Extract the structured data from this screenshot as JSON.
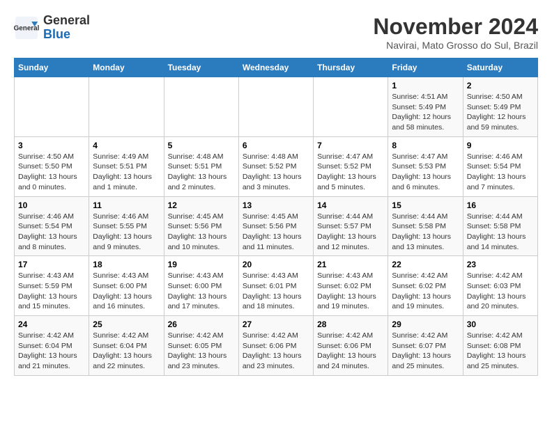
{
  "header": {
    "logo_line1": "General",
    "logo_line2": "Blue",
    "month_title": "November 2024",
    "location": "Navirai, Mato Grosso do Sul, Brazil"
  },
  "weekdays": [
    "Sunday",
    "Monday",
    "Tuesday",
    "Wednesday",
    "Thursday",
    "Friday",
    "Saturday"
  ],
  "weeks": [
    [
      {
        "day": "",
        "detail": ""
      },
      {
        "day": "",
        "detail": ""
      },
      {
        "day": "",
        "detail": ""
      },
      {
        "day": "",
        "detail": ""
      },
      {
        "day": "",
        "detail": ""
      },
      {
        "day": "1",
        "detail": "Sunrise: 4:51 AM\nSunset: 5:49 PM\nDaylight: 12 hours and 58 minutes."
      },
      {
        "day": "2",
        "detail": "Sunrise: 4:50 AM\nSunset: 5:49 PM\nDaylight: 12 hours and 59 minutes."
      }
    ],
    [
      {
        "day": "3",
        "detail": "Sunrise: 4:50 AM\nSunset: 5:50 PM\nDaylight: 13 hours and 0 minutes."
      },
      {
        "day": "4",
        "detail": "Sunrise: 4:49 AM\nSunset: 5:51 PM\nDaylight: 13 hours and 1 minute."
      },
      {
        "day": "5",
        "detail": "Sunrise: 4:48 AM\nSunset: 5:51 PM\nDaylight: 13 hours and 2 minutes."
      },
      {
        "day": "6",
        "detail": "Sunrise: 4:48 AM\nSunset: 5:52 PM\nDaylight: 13 hours and 3 minutes."
      },
      {
        "day": "7",
        "detail": "Sunrise: 4:47 AM\nSunset: 5:52 PM\nDaylight: 13 hours and 5 minutes."
      },
      {
        "day": "8",
        "detail": "Sunrise: 4:47 AM\nSunset: 5:53 PM\nDaylight: 13 hours and 6 minutes."
      },
      {
        "day": "9",
        "detail": "Sunrise: 4:46 AM\nSunset: 5:54 PM\nDaylight: 13 hours and 7 minutes."
      }
    ],
    [
      {
        "day": "10",
        "detail": "Sunrise: 4:46 AM\nSunset: 5:54 PM\nDaylight: 13 hours and 8 minutes."
      },
      {
        "day": "11",
        "detail": "Sunrise: 4:46 AM\nSunset: 5:55 PM\nDaylight: 13 hours and 9 minutes."
      },
      {
        "day": "12",
        "detail": "Sunrise: 4:45 AM\nSunset: 5:56 PM\nDaylight: 13 hours and 10 minutes."
      },
      {
        "day": "13",
        "detail": "Sunrise: 4:45 AM\nSunset: 5:56 PM\nDaylight: 13 hours and 11 minutes."
      },
      {
        "day": "14",
        "detail": "Sunrise: 4:44 AM\nSunset: 5:57 PM\nDaylight: 13 hours and 12 minutes."
      },
      {
        "day": "15",
        "detail": "Sunrise: 4:44 AM\nSunset: 5:58 PM\nDaylight: 13 hours and 13 minutes."
      },
      {
        "day": "16",
        "detail": "Sunrise: 4:44 AM\nSunset: 5:58 PM\nDaylight: 13 hours and 14 minutes."
      }
    ],
    [
      {
        "day": "17",
        "detail": "Sunrise: 4:43 AM\nSunset: 5:59 PM\nDaylight: 13 hours and 15 minutes."
      },
      {
        "day": "18",
        "detail": "Sunrise: 4:43 AM\nSunset: 6:00 PM\nDaylight: 13 hours and 16 minutes."
      },
      {
        "day": "19",
        "detail": "Sunrise: 4:43 AM\nSunset: 6:00 PM\nDaylight: 13 hours and 17 minutes."
      },
      {
        "day": "20",
        "detail": "Sunrise: 4:43 AM\nSunset: 6:01 PM\nDaylight: 13 hours and 18 minutes."
      },
      {
        "day": "21",
        "detail": "Sunrise: 4:43 AM\nSunset: 6:02 PM\nDaylight: 13 hours and 19 minutes."
      },
      {
        "day": "22",
        "detail": "Sunrise: 4:42 AM\nSunset: 6:02 PM\nDaylight: 13 hours and 19 minutes."
      },
      {
        "day": "23",
        "detail": "Sunrise: 4:42 AM\nSunset: 6:03 PM\nDaylight: 13 hours and 20 minutes."
      }
    ],
    [
      {
        "day": "24",
        "detail": "Sunrise: 4:42 AM\nSunset: 6:04 PM\nDaylight: 13 hours and 21 minutes."
      },
      {
        "day": "25",
        "detail": "Sunrise: 4:42 AM\nSunset: 6:04 PM\nDaylight: 13 hours and 22 minutes."
      },
      {
        "day": "26",
        "detail": "Sunrise: 4:42 AM\nSunset: 6:05 PM\nDaylight: 13 hours and 23 minutes."
      },
      {
        "day": "27",
        "detail": "Sunrise: 4:42 AM\nSunset: 6:06 PM\nDaylight: 13 hours and 23 minutes."
      },
      {
        "day": "28",
        "detail": "Sunrise: 4:42 AM\nSunset: 6:06 PM\nDaylight: 13 hours and 24 minutes."
      },
      {
        "day": "29",
        "detail": "Sunrise: 4:42 AM\nSunset: 6:07 PM\nDaylight: 13 hours and 25 minutes."
      },
      {
        "day": "30",
        "detail": "Sunrise: 4:42 AM\nSunset: 6:08 PM\nDaylight: 13 hours and 25 minutes."
      }
    ]
  ]
}
